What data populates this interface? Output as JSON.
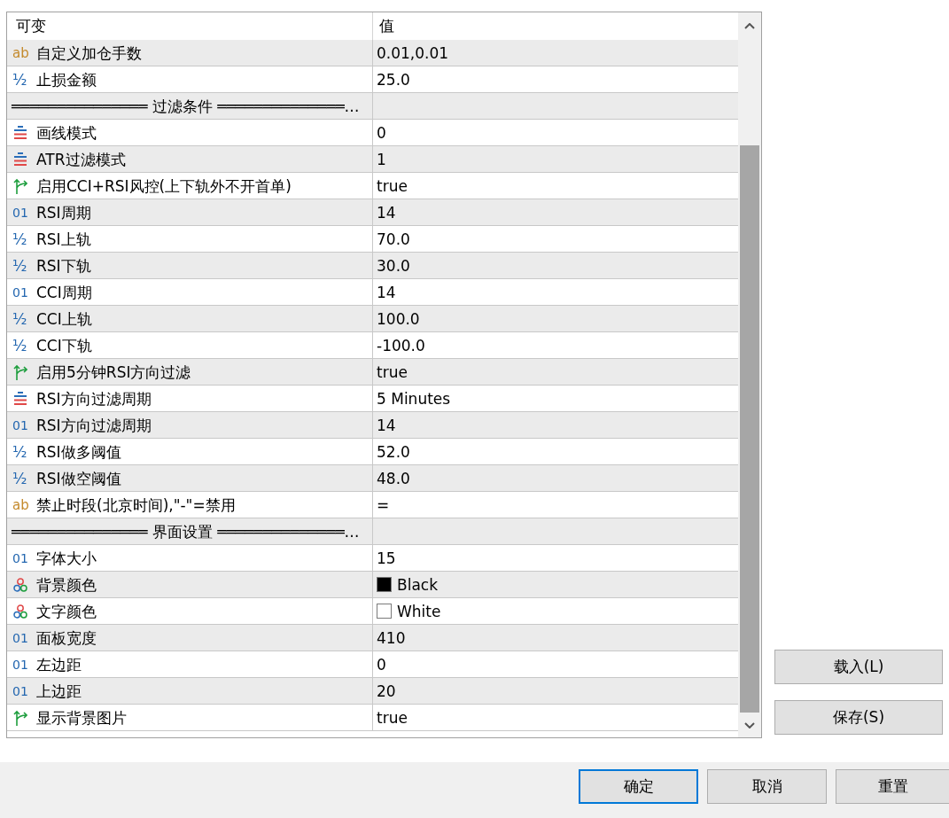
{
  "table": {
    "columns": [
      "可变",
      "值"
    ],
    "rows": [
      {
        "kind": "string",
        "icon": "ab",
        "name": "自定义加仓手数",
        "value": "0.01,0.01"
      },
      {
        "kind": "double",
        "icon": "½",
        "name": "止损金额",
        "value": "25.0"
      },
      {
        "kind": "section",
        "name": "═══════════════ 过滤条件 ══════════════…"
      },
      {
        "kind": "enum",
        "name": "画线模式",
        "value": "0"
      },
      {
        "kind": "enum",
        "name": "ATR过滤模式",
        "value": "1"
      },
      {
        "kind": "bool",
        "name": "启用CCI+RSI风控(上下轨外不开首单)",
        "value": "true"
      },
      {
        "kind": "integer",
        "icon": "01",
        "name": "RSI周期",
        "value": "14"
      },
      {
        "kind": "double",
        "icon": "½",
        "name": "RSI上轨",
        "value": "70.0"
      },
      {
        "kind": "double",
        "icon": "½",
        "name": "RSI下轨",
        "value": "30.0"
      },
      {
        "kind": "integer",
        "icon": "01",
        "name": "CCI周期",
        "value": "14"
      },
      {
        "kind": "double",
        "icon": "½",
        "name": "CCI上轨",
        "value": "100.0"
      },
      {
        "kind": "double",
        "icon": "½",
        "name": "CCI下轨",
        "value": "-100.0"
      },
      {
        "kind": "bool",
        "name": "启用5分钟RSI方向过滤",
        "value": "true"
      },
      {
        "kind": "enum",
        "name": "RSI方向过滤周期",
        "value": "5 Minutes"
      },
      {
        "kind": "integer",
        "icon": "01",
        "name": "RSI方向过滤周期",
        "value": "14"
      },
      {
        "kind": "double",
        "icon": "½",
        "name": "RSI做多阈值",
        "value": "52.0"
      },
      {
        "kind": "double",
        "icon": "½",
        "name": "RSI做空阈值",
        "value": "48.0"
      },
      {
        "kind": "string",
        "icon": "ab",
        "name": "禁止时段(北京时间),\"-\"=禁用",
        "value": "="
      },
      {
        "kind": "section",
        "name": "═══════════════ 界面设置 ══════════════…"
      },
      {
        "kind": "integer",
        "icon": "01",
        "name": "字体大小",
        "value": "15"
      },
      {
        "kind": "color",
        "name": "背景颜色",
        "value": "Black",
        "color": "#000000"
      },
      {
        "kind": "color",
        "name": "文字颜色",
        "value": "White",
        "color": "#ffffff"
      },
      {
        "kind": "integer",
        "icon": "01",
        "name": "面板宽度",
        "value": "410"
      },
      {
        "kind": "integer",
        "icon": "01",
        "name": "左边距",
        "value": "0"
      },
      {
        "kind": "integer",
        "icon": "01",
        "name": "上边距",
        "value": "20"
      },
      {
        "kind": "bool",
        "name": "显示背景图片",
        "value": "true"
      }
    ]
  },
  "side_buttons": [
    "载入(L)",
    "保存(S)"
  ],
  "dialog_buttons": [
    {
      "label": "确定",
      "focused": true
    },
    {
      "label": "取消",
      "focused": false
    },
    {
      "label": "重置",
      "focused": false
    }
  ]
}
